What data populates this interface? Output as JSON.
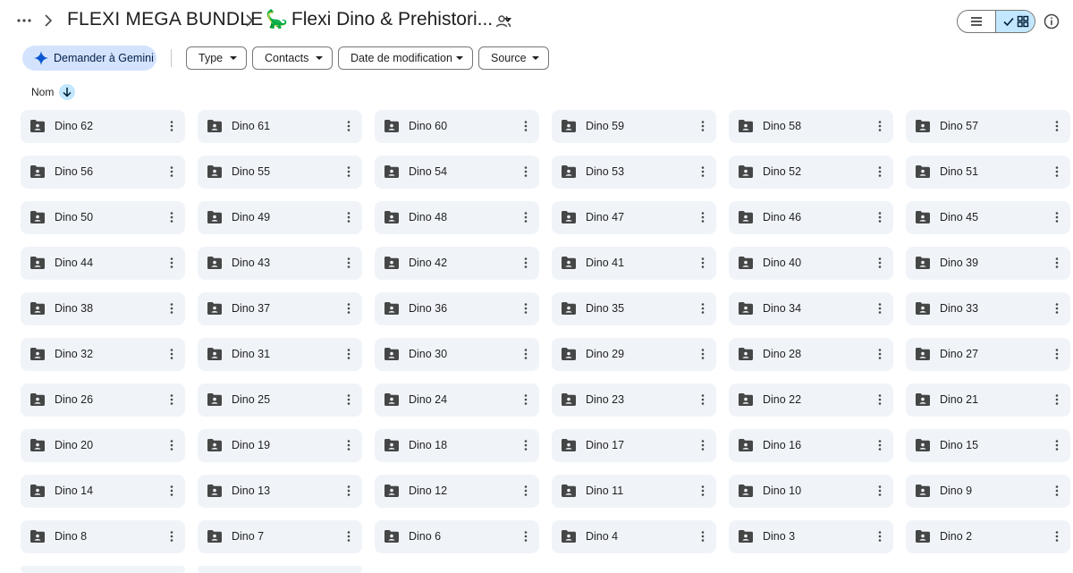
{
  "header": {
    "more_icon": "more-horiz-icon",
    "breadcrumb_root": "FLEXI MEGA BUNDLE",
    "breadcrumb_emoji": "🦕",
    "breadcrumb_current": "Flexi Dino & Prehistori...",
    "shared_icon": "shared-people-icon",
    "info_icon": "info-icon"
  },
  "filters": {
    "gemini_label": "Demander à Gemini",
    "type_label": "Type",
    "contacts_label": "Contacts",
    "date_label": "Date de modification",
    "source_label": "Source"
  },
  "sort": {
    "label": "Nom",
    "direction_icon": "arrow-downward-icon"
  },
  "colors": {
    "accent_light": "#c2e7ff",
    "gemini_bg": "#d3e3fd",
    "card_bg": "#f0f4f9",
    "text": "#1f1f1f"
  },
  "folders": [
    "Dino 62",
    "Dino 61",
    "Dino 60",
    "Dino 59",
    "Dino 58",
    "Dino 57",
    "Dino 56",
    "Dino 55",
    "Dino 54",
    "Dino 53",
    "Dino 52",
    "Dino 51",
    "Dino 50",
    "Dino 49",
    "Dino 48",
    "Dino 47",
    "Dino 46",
    "Dino 45",
    "Dino 44",
    "Dino 43",
    "Dino 42",
    "Dino 41",
    "Dino 40",
    "Dino 39",
    "Dino 38",
    "Dino 37",
    "Dino 36",
    "Dino 35",
    "Dino 34",
    "Dino 33",
    "Dino 32",
    "Dino 31",
    "Dino 30",
    "Dino 29",
    "Dino 28",
    "Dino 27",
    "Dino 26",
    "Dino 25",
    "Dino 24",
    "Dino 23",
    "Dino 22",
    "Dino 21",
    "Dino 20",
    "Dino 19",
    "Dino 18",
    "Dino 17",
    "Dino 16",
    "Dino 15",
    "Dino 14",
    "Dino 13",
    "Dino 12",
    "Dino 11",
    "Dino 10",
    "Dino 9",
    "Dino 8",
    "Dino 7",
    "Dino 6",
    "Dino 4",
    "Dino 3",
    "Dino 2"
  ]
}
